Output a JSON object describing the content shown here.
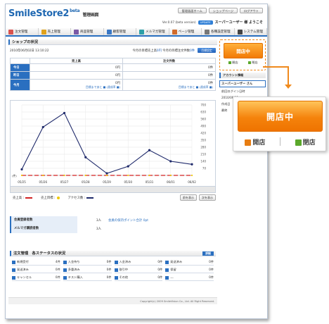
{
  "header": {
    "logo": "SmileStore2",
    "logo_beta": "beta",
    "logo_sub": "管理画面",
    "top_links": [
      "管理画面ホーム",
      "ショップページ",
      "ログアウト"
    ],
    "version": "Ver.0.07 (beta version)",
    "update_badge": "UPDATE",
    "user_greeting": "スーパーユーザー 様 ようこそ"
  },
  "nav": [
    {
      "label": "注文管理",
      "color": "#d9534f"
    },
    {
      "label": "売上管理",
      "color": "#e0a21d"
    },
    {
      "label": "商品管理",
      "color": "#7b5aa6"
    },
    {
      "label": "顧客管理",
      "color": "#3a78c5"
    },
    {
      "label": "メルマガ管理",
      "color": "#2ea0a8"
    },
    {
      "label": "ページ管理",
      "color": "#d26b2a"
    },
    {
      "label": "各種設定管理",
      "color": "#777777"
    },
    {
      "label": "システム管理",
      "color": "#444444"
    }
  ],
  "shop": {
    "title": "ショップの状況",
    "date": "2010年06月02日 13:10:22",
    "goal_text_1": "今月の目標売上高",
    "goal_val_1": "0円",
    "goal_text_2": "今月の目標注文件数",
    "goal_val_2": "0件",
    "goal_button": "目標設定",
    "col_sales": "売上高",
    "col_orders": "注文件数",
    "rows": [
      {
        "label": "今日",
        "sales": "0円",
        "orders": "0件"
      },
      {
        "label": "昨日",
        "sales": "0円",
        "orders": "0件"
      },
      {
        "label": "今月",
        "sales": "0円",
        "orders": "0件",
        "sales_sub": "目標まであと ■ (達成率 ■)",
        "orders_sub": "目標まであと ■ (達成率 ■)"
      }
    ]
  },
  "chart_data": {
    "type": "line",
    "categories": [
      "05/25",
      "05/26",
      "05/27",
      "05/28",
      "05/29",
      "05/30",
      "05/31",
      "06/01",
      "06/02"
    ],
    "series": [
      {
        "name": "アクセス数",
        "values": [
          60,
          480,
          620,
          180,
          20,
          90,
          250,
          140,
          110
        ]
      },
      {
        "name": "売上高",
        "values": [
          0,
          0,
          0,
          0,
          0,
          0,
          0,
          0,
          0
        ]
      },
      {
        "name": "売上目標",
        "values": [
          0,
          0,
          0,
          0,
          0,
          0,
          0,
          0,
          0
        ]
      }
    ],
    "y_ticks": [
      "700",
      "630",
      "560",
      "490",
      "420",
      "350",
      "280",
      "210",
      "140",
      "70"
    ],
    "ylim": [
      0,
      700
    ],
    "left_label": "(件)",
    "grid": true,
    "colors": {
      "access": "#1f2a6b",
      "sales": "#d22222",
      "target": "#f0c800"
    }
  },
  "legend": {
    "sales": "売上高 :",
    "target": "売上目標 :",
    "access": "アクセス数 :",
    "btn_back": "前を表示",
    "btn_next": "次を表示"
  },
  "members": {
    "label_members": "会員登録者数",
    "val_members": "3人",
    "points_link": "会員の保持ポイント合計",
    "points_val": "0pt",
    "label_mailmag": "メルマガ購読者数",
    "val_mailmag": "3人"
  },
  "orders": {
    "title": "注文管理　各ステータスの状況",
    "more": "詳細",
    "items": [
      {
        "name": "新規受付",
        "count": "4件"
      },
      {
        "name": "入金待ち",
        "count": "0件"
      },
      {
        "name": "入金済み",
        "count": "0件"
      },
      {
        "name": "発送済み",
        "count": "0件"
      },
      {
        "name": "発送済み",
        "count": "0件"
      },
      {
        "name": "多重済み",
        "count": "0件"
      },
      {
        "name": "取引中",
        "count": "0件"
      },
      {
        "name": "保留",
        "count": "0件"
      },
      {
        "name": "キャンセル",
        "count": "0件"
      },
      {
        "name": "テスト購入",
        "count": "0件"
      },
      {
        "name": "その他",
        "count": "0件"
      },
      {
        "name": "---",
        "count": "0件"
      }
    ]
  },
  "footer": {
    "copyright": "Copyright(c) 2009 SmileVision Co., Ltd. All Right Reserved."
  },
  "sidebar": {
    "store_status": "開店中",
    "open_label": "開店",
    "close_label": "閉店",
    "account_title": "アカウント情報",
    "user_name": "スーパーユーザー さん",
    "links": [
      "前回ログイン日時",
      "2010/06/01",
      "作成日",
      "最終"
    ]
  },
  "callout": {
    "status": "開店中",
    "open_label": "開店",
    "close_label": "閉店"
  }
}
